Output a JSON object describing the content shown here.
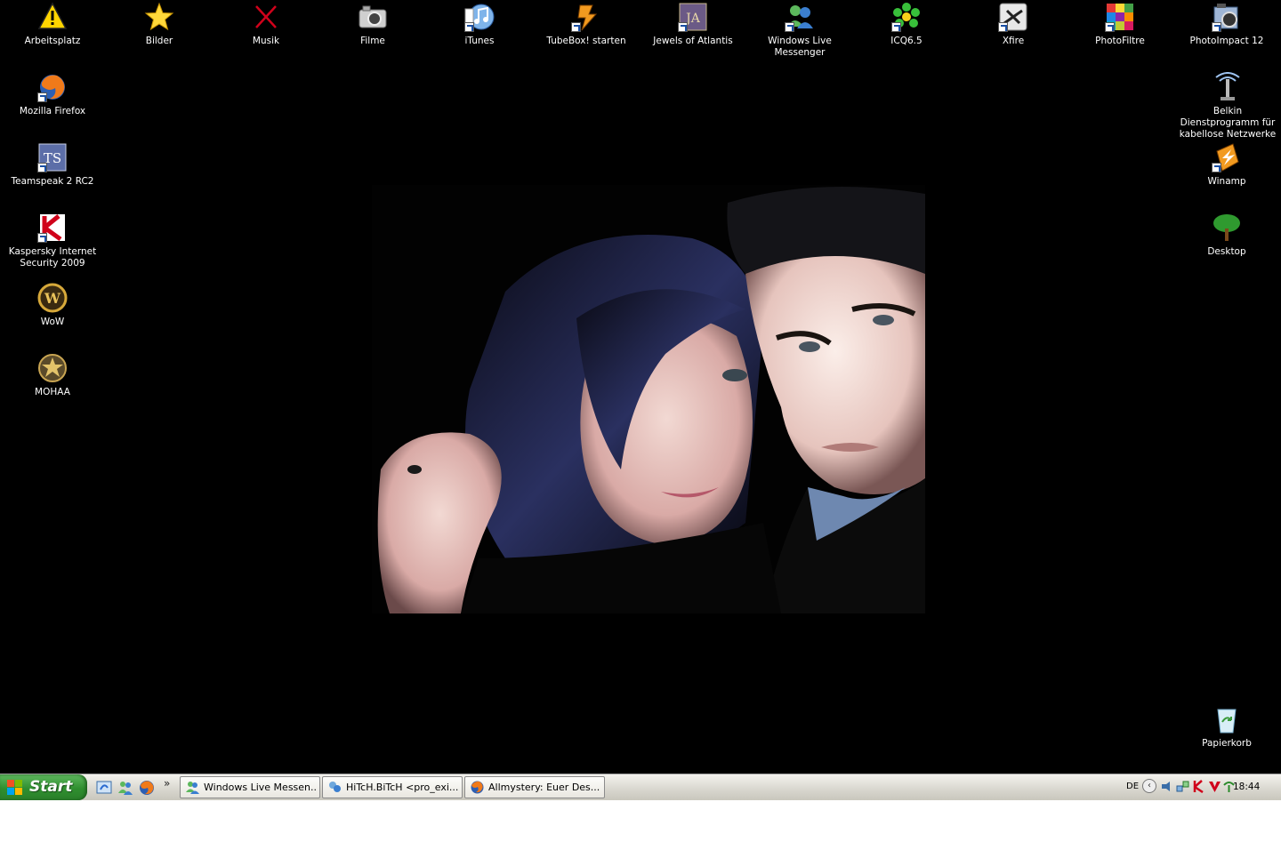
{
  "desktop": {
    "icons": [
      {
        "id": "arbeitsplatz",
        "label": "Arbeitsplatz"
      },
      {
        "id": "bilder",
        "label": "Bilder"
      },
      {
        "id": "musik",
        "label": "Musik"
      },
      {
        "id": "filme",
        "label": "Filme"
      },
      {
        "id": "itunes",
        "label": "iTunes"
      },
      {
        "id": "tubebox",
        "label": "TubeBox! starten"
      },
      {
        "id": "jewels",
        "label": "Jewels of Atlantis"
      },
      {
        "id": "wlm",
        "label": "Windows Live Messenger"
      },
      {
        "id": "icq",
        "label": "ICQ6.5"
      },
      {
        "id": "xfire",
        "label": "Xfire"
      },
      {
        "id": "photofiltre",
        "label": "PhotoFiltre"
      },
      {
        "id": "photoimpact",
        "label": "PhotoImpact 12"
      },
      {
        "id": "firefox",
        "label": "Mozilla Firefox"
      },
      {
        "id": "teamspeak",
        "label": "Teamspeak 2 RC2"
      },
      {
        "id": "kaspersky",
        "label": "Kaspersky Internet Security 2009"
      },
      {
        "id": "wow",
        "label": "WoW"
      },
      {
        "id": "mohaa",
        "label": "MOHAA"
      },
      {
        "id": "belkin",
        "label": "Belkin Dienstprogramm für kabellose Netzwerke"
      },
      {
        "id": "winamp",
        "label": "Winamp"
      },
      {
        "id": "desktop",
        "label": "Desktop"
      },
      {
        "id": "papierkorb",
        "label": "Papierkorb"
      }
    ]
  },
  "taskbar": {
    "start_label": "Start",
    "ql_more": "»",
    "tasks": [
      {
        "label": "Windows Live Messen..."
      },
      {
        "label": "HiTcH.BiTcH <pro_exi..."
      },
      {
        "label": "Allmystery: Euer Des..."
      }
    ],
    "tray": {
      "language": "DE",
      "arrow": "‹",
      "clock": "18:44"
    }
  },
  "colors": {
    "desktop_bg": "#000000",
    "start_green": "#2f8f2f",
    "taskbar_bg": "#d8d6ce"
  }
}
